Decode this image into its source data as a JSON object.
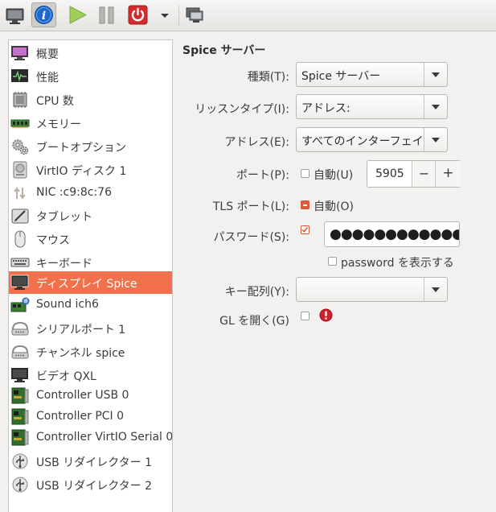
{
  "toolbar": {
    "buttons": [
      {
        "icon": "monitor-icon",
        "name": "show-console"
      },
      {
        "icon": "info-icon",
        "name": "show-details"
      },
      {
        "icon": "play-icon",
        "name": "run"
      },
      {
        "icon": "pause-icon",
        "name": "pause"
      },
      {
        "icon": "power-icon",
        "name": "shutdown"
      },
      {
        "icon": "chevron-down-icon",
        "name": "shutdown-menu"
      },
      {
        "icon": "snapshot-icon",
        "name": "snapshots"
      }
    ],
    "accent_red": "#d42b2b",
    "accent_green": "#8fbf49",
    "info_blue": "#1d68c9"
  },
  "sidebar": {
    "items": [
      {
        "label": "概要",
        "icon": "overview-monitor-icon"
      },
      {
        "label": "性能",
        "icon": "performance-graph-icon"
      },
      {
        "label": "CPU 数",
        "icon": "cpu-chip-icon"
      },
      {
        "label": "メモリー",
        "icon": "memory-module-icon"
      },
      {
        "label": "ブートオプション",
        "icon": "boot-gears-icon"
      },
      {
        "label": "VirtIO ディスク 1",
        "icon": "disk-drive-icon"
      },
      {
        "label": "NIC :c9:8c:76",
        "icon": "network-arrows-icon"
      },
      {
        "label": "タブレット",
        "icon": "tablet-pen-icon"
      },
      {
        "label": "マウス",
        "icon": "mouse-icon"
      },
      {
        "label": "キーボード",
        "icon": "keyboard-icon"
      },
      {
        "label": "ディスプレイ Spice",
        "icon": "display-monitor-icon",
        "selected": true
      },
      {
        "label": "Sound ich6",
        "icon": "sound-card-icon"
      },
      {
        "label": "シリアルポート 1",
        "icon": "serial-port-icon"
      },
      {
        "label": "チャンネル spice",
        "icon": "channel-port-icon"
      },
      {
        "label": "ビデオ QXL",
        "icon": "video-monitor-icon"
      },
      {
        "label": "Controller USB 0",
        "icon": "controller-card-icon"
      },
      {
        "label": "Controller PCI 0",
        "icon": "controller-card-icon"
      },
      {
        "label": "Controller VirtIO Serial 0",
        "icon": "controller-card-icon"
      },
      {
        "label": "USB リダイレクター 1",
        "icon": "usb-plug-icon"
      },
      {
        "label": "USB リダイレクター 2",
        "icon": "usb-plug-icon"
      }
    ],
    "selected_color": "#f0714c"
  },
  "panel": {
    "title": "Spice サーバー",
    "type": {
      "label": "種類(T):",
      "value": "Spice サーバー"
    },
    "listen": {
      "label": "リッスンタイプ(I):",
      "value": "アドレス:"
    },
    "address": {
      "label": "アドレス(E):",
      "value": "すべてのインターフェイス"
    },
    "port": {
      "label": "ポート(P):",
      "auto_label": "自動(U)",
      "auto_checked": false,
      "value": "5905",
      "minus": "−",
      "plus": "+"
    },
    "tls": {
      "label": "TLS ポート(L):",
      "auto_label": "自動(O)",
      "state": "indeterminate"
    },
    "password": {
      "label": "パスワード(S):",
      "checked": true,
      "masked": "●●●●●●●●●●●●",
      "show_label": "password を表示する",
      "show_checked": false
    },
    "keymap": {
      "label": "キー配列(Y):",
      "value": ""
    },
    "gl": {
      "label": "GL を開く(G)",
      "checked": false,
      "warning_icon": "warning-icon",
      "warning_color": "#d0202a"
    }
  }
}
